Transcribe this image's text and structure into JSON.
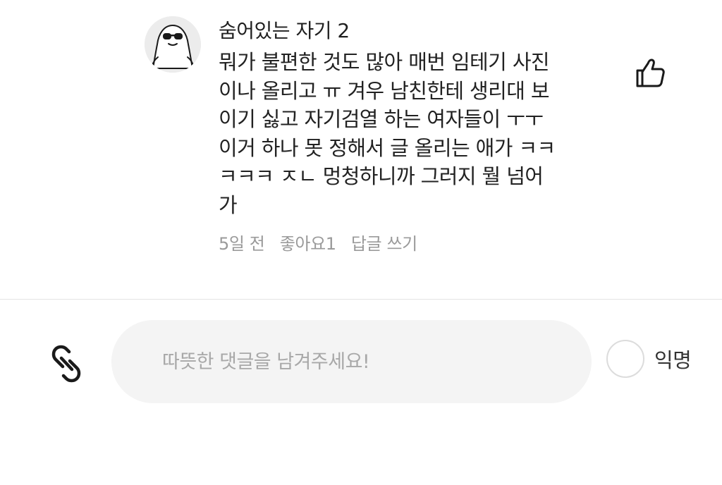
{
  "comment": {
    "author": "숨어있는 자기 2",
    "avatar_icon": "sunglasses-character-avatar",
    "body_lines": [
      "뭐가 불편한 것도 많아 매번 임테기 사진",
      "이나 올리고 ㅠ 겨우 남친한테 생리대 보",
      "이기 싫고 자기검열 하는 여자들이 ㅜㅜ",
      "이거 하나 못 정해서 글 올리는 애가 ㅋㅋ",
      "ㅋㅋㅋ ㅈㄴ 멍청하니까 그러지 뭘 넘어",
      "가"
    ],
    "time": "5일 전",
    "likes": "좋아요1",
    "reply_label": "답글 쓰기",
    "like_icon": "thumbs-up-icon"
  },
  "input_bar": {
    "attach_icon": "link-icon",
    "placeholder": "따뜻한 댓글을 남겨주세요!",
    "anonymous_label": "익명"
  }
}
